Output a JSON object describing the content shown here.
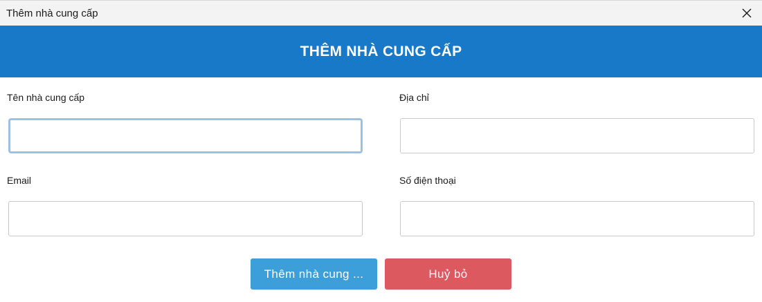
{
  "window": {
    "title": "Thêm nhà cung cấp"
  },
  "header": {
    "title": "THÊM NHÀ CUNG CẤP"
  },
  "form": {
    "supplier_name": {
      "label": "Tên nhà cung cấp",
      "value": "",
      "placeholder": ""
    },
    "address": {
      "label": "Địa chỉ",
      "value": "",
      "placeholder": ""
    },
    "email": {
      "label": "Email",
      "value": "",
      "placeholder": ""
    },
    "phone": {
      "label": "Số điện thoại",
      "value": "",
      "placeholder": ""
    }
  },
  "actions": {
    "add_label": "Thêm nhà cung ...",
    "cancel_label": "Huỷ bỏ"
  },
  "colors": {
    "header_bg": "#1779c8",
    "add_button": "#3d9fd9",
    "cancel_button": "#dc5960",
    "focus_ring": "#9cc1e3"
  },
  "icons": {
    "close": "close-icon"
  }
}
